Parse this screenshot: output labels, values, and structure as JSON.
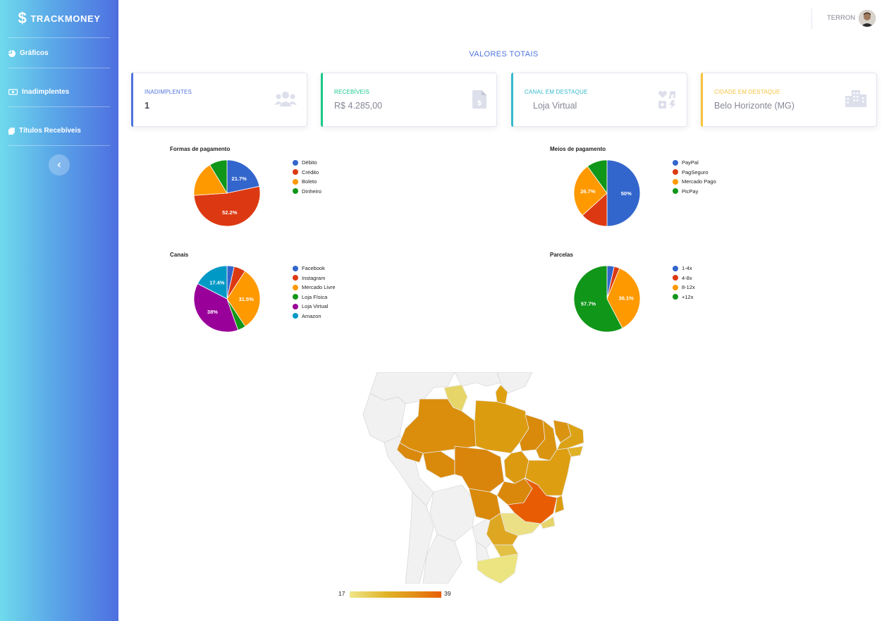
{
  "app": {
    "brand": "TRACKMONEY"
  },
  "sidebar": {
    "items": [
      {
        "label": "Gráficos",
        "icon": "pie-chart-icon"
      },
      {
        "label": "Inadimplentes",
        "icon": "money-bill-icon"
      },
      {
        "label": "Títulos Recebíveis",
        "icon": "documents-icon"
      }
    ],
    "collapse_icon": "chevron-left-icon"
  },
  "topbar": {
    "user_name": "TERRON"
  },
  "page": {
    "title": "VALORES TOTAIS"
  },
  "cards": [
    {
      "label": "INADIMPLENTES",
      "value": "1",
      "color": "#4e73df",
      "icon": "users-icon"
    },
    {
      "label": "RECEBÍVEIS",
      "value": "R$ 4.285,00",
      "color": "#1cc88a",
      "icon": "invoice-dollar-icon"
    },
    {
      "label": "CANAL EM DESTAQUE",
      "value": "Loja Virtual",
      "color": "#36b9cc",
      "icon": "shapes-icon"
    },
    {
      "label": "CIDADE EM DESTAQUE",
      "value": "Belo Horizonte (MG)",
      "color": "#f6c23e",
      "icon": "city-icon"
    }
  ],
  "chart_data": [
    {
      "type": "pie",
      "title": "Formas de pagamento",
      "categories": [
        "Débito",
        "Crédito",
        "Boleto",
        "Dinheiro"
      ],
      "values": [
        21.7,
        52.2,
        17.4,
        8.7
      ],
      "labels": [
        "21.7%",
        "52.2%",
        "",
        ""
      ],
      "colors": [
        "#3366cc",
        "#dc3912",
        "#ff9900",
        "#109618"
      ],
      "legend": "right"
    },
    {
      "type": "pie",
      "title": "Meios de pagamento",
      "categories": [
        "PayPal",
        "PagSeguro",
        "Mercado Pago",
        "PicPay"
      ],
      "values": [
        50,
        13.3,
        26.7,
        10
      ],
      "labels": [
        "50%",
        "",
        "26.7%",
        ""
      ],
      "colors": [
        "#3366cc",
        "#dc3912",
        "#ff9900",
        "#109618"
      ],
      "legend": "right"
    },
    {
      "type": "pie",
      "title": "Canais",
      "categories": [
        "Facebook",
        "Instagram",
        "Mercado Livre",
        "Loja Física",
        "Loja Virtual",
        "Amazon"
      ],
      "values": [
        3.5,
        5.7,
        31.5,
        3.9,
        38,
        17.4
      ],
      "labels": [
        "",
        "",
        "31.5%",
        "",
        "38%",
        "17.4%"
      ],
      "colors": [
        "#3366cc",
        "#dc3912",
        "#ff9900",
        "#109618",
        "#990099",
        "#0099c6"
      ],
      "legend": "right"
    },
    {
      "type": "pie",
      "title": "Parcelas",
      "categories": [
        "1-4x",
        "4-8x",
        "8-12x",
        "+12x"
      ],
      "values": [
        3.5,
        2.7,
        36.1,
        57.7
      ],
      "labels": [
        "",
        "",
        "36.1%",
        "57.7%"
      ],
      "colors": [
        "#3366cc",
        "#dc3912",
        "#ff9900",
        "#109618"
      ],
      "legend": "right"
    }
  ],
  "map": {
    "scale_min": "17",
    "scale_max": "39",
    "color_min": "#efe68a",
    "color_max": "#e85d04"
  }
}
